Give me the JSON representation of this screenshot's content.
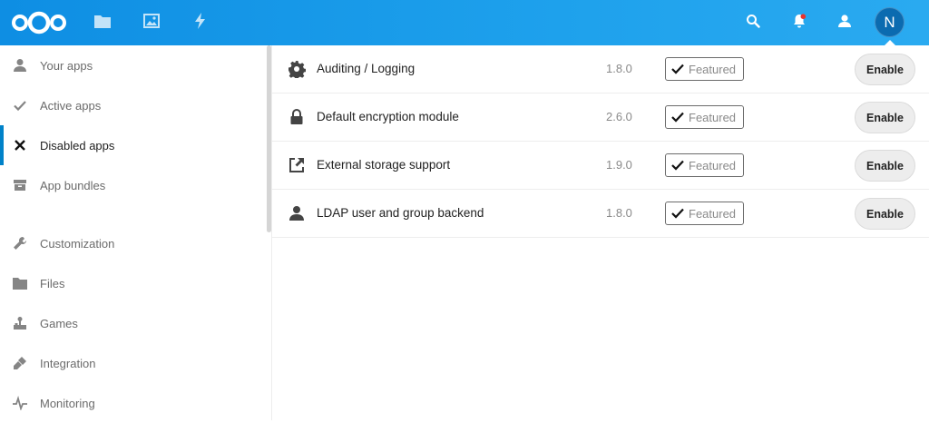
{
  "header": {
    "apps": [
      {
        "name": "Files",
        "icon": "folder-icon"
      },
      {
        "name": "Photos",
        "icon": "image-icon"
      },
      {
        "name": "Activity",
        "icon": "lightning-icon"
      }
    ],
    "avatar_initial": "N",
    "colors": {
      "accent": "#0082c9",
      "header_start": "#0e8ee3",
      "header_end": "#2aaaf0",
      "notification_dot": "#e9322d"
    }
  },
  "sidebar": {
    "items": [
      {
        "label": "Your apps",
        "icon": "user-icon",
        "active": false
      },
      {
        "label": "Active apps",
        "icon": "checkmark-icon",
        "active": false
      },
      {
        "label": "Disabled apps",
        "icon": "close-icon",
        "active": true
      },
      {
        "label": "App bundles",
        "icon": "archive-icon",
        "active": false
      },
      {
        "label": "Customization",
        "icon": "wrench-icon",
        "active": false
      },
      {
        "label": "Files",
        "icon": "folder-icon",
        "active": false
      },
      {
        "label": "Games",
        "icon": "joystick-icon",
        "active": false
      },
      {
        "label": "Integration",
        "icon": "plug-icon",
        "active": false
      },
      {
        "label": "Monitoring",
        "icon": "pulse-icon",
        "active": false
      }
    ]
  },
  "apps": [
    {
      "name": "Auditing / Logging",
      "version": "1.8.0",
      "badge": "Featured",
      "action": "Enable",
      "icon": "gear-icon"
    },
    {
      "name": "Default encryption module",
      "version": "2.6.0",
      "badge": "Featured",
      "action": "Enable",
      "icon": "lock-icon"
    },
    {
      "name": "External storage support",
      "version": "1.9.0",
      "badge": "Featured",
      "action": "Enable",
      "icon": "external-link-icon"
    },
    {
      "name": "LDAP user and group backend",
      "version": "1.8.0",
      "badge": "Featured",
      "action": "Enable",
      "icon": "user-icon"
    }
  ]
}
